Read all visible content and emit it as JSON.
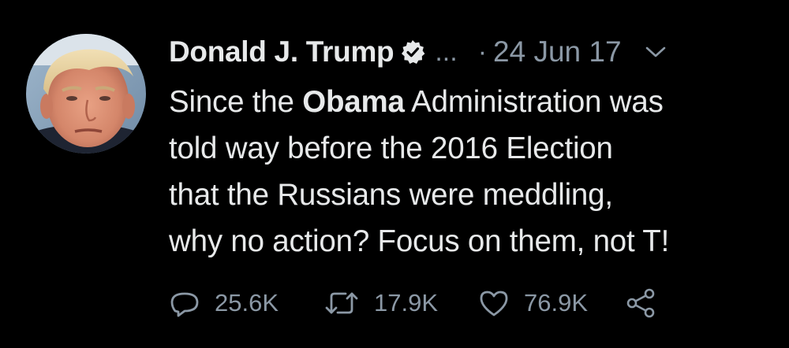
{
  "tweet": {
    "author_name": "Donald J. Trump",
    "handle_truncated": "...",
    "separator": "·",
    "date": "24 Jun 17",
    "text": {
      "line1_pre": "Since the ",
      "line1_bold": "Obama",
      "line1_post": " Administration was",
      "line2": "told way before the 2016 Election",
      "line3": "that the Russians were meddling,",
      "line4": "why no action? Focus on them, not T!"
    },
    "stats": {
      "replies": "25.6K",
      "retweets": "17.9K",
      "likes": "76.9K"
    }
  },
  "icons": [
    "verified-icon",
    "chevron-down-icon",
    "reply-icon",
    "retweet-icon",
    "like-icon",
    "share-icon"
  ],
  "colors": {
    "background": "#000000",
    "primary_text": "#e7e9ea",
    "secondary_text": "#8b98a5"
  }
}
